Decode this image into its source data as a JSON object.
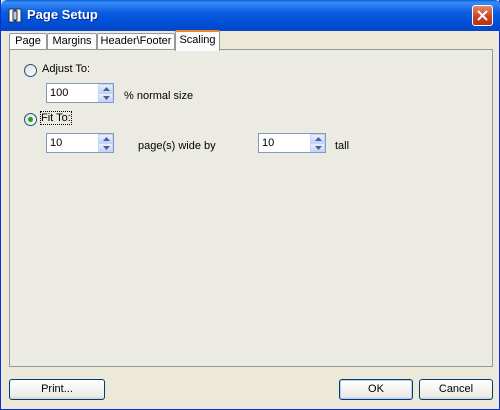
{
  "window": {
    "title": "Page Setup",
    "icon": "page-setup-icon",
    "close_icon": "close-icon"
  },
  "tabs": [
    {
      "label": "Page",
      "active": false
    },
    {
      "label": "Margins",
      "active": false
    },
    {
      "label": "Header\\Footer",
      "active": false
    },
    {
      "label": "Scaling",
      "active": true
    }
  ],
  "scaling": {
    "adjust_to": {
      "label": "Adjust To:",
      "selected": false,
      "value": "100",
      "suffix": "% normal size"
    },
    "fit_to": {
      "label": "Fit To:",
      "selected": true,
      "wide_value": "10",
      "wide_suffix": "page(s) wide by",
      "tall_value": "10",
      "tall_suffix": "tall"
    }
  },
  "buttons": {
    "print": "Print...",
    "ok": "OK",
    "cancel": "Cancel"
  },
  "colors": {
    "titlebar": "#0054e3",
    "dialog_bg": "#ece9d8",
    "active_tab_accent": "#e68b2c",
    "radio_dot": "#21a121"
  }
}
